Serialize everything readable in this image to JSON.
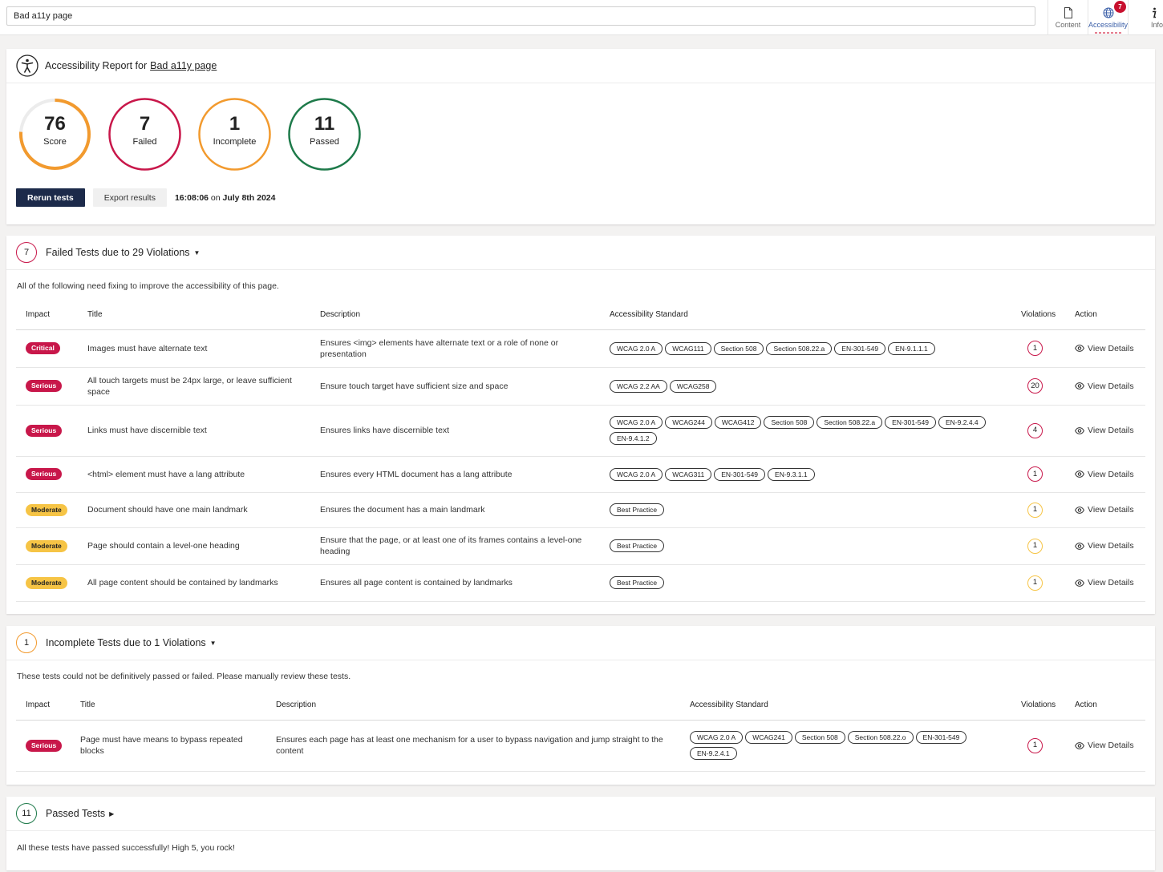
{
  "page_title_value": "Bad a11y page",
  "nav": [
    {
      "label": "Content",
      "icon": "document-icon"
    },
    {
      "label": "Accessibility",
      "icon": "globe-icon",
      "badge": "7"
    },
    {
      "label": "Info",
      "icon": "info-icon"
    }
  ],
  "report": {
    "heading": "Accessibility Report for",
    "page_link": "Bad a11y page",
    "score": {
      "value": "76",
      "label": "Score",
      "percent": 76
    },
    "failed": {
      "value": "7",
      "label": "Failed"
    },
    "incomplete": {
      "value": "1",
      "label": "Incomplete"
    },
    "passed": {
      "value": "11",
      "label": "Passed"
    },
    "rerun_label": "Rerun tests",
    "export_label": "Export results",
    "time": "16:08:06",
    "time_sep": " on ",
    "date": "July 8th 2024"
  },
  "colors": {
    "critical": "#c8174a",
    "moderate": "#f6c445",
    "passed": "#1e7a4a",
    "score": "#f29a2e",
    "navy": "#1c2a4a"
  },
  "failed_section": {
    "count": "7",
    "title": "Failed Tests due to 29 Violations",
    "intro": "All of the following need fixing to improve the accessibility of this page.",
    "columns": {
      "impact": "Impact",
      "title": "Title",
      "description": "Description",
      "standard": "Accessibility Standard",
      "violations": "Violations",
      "action": "Action"
    },
    "rows": [
      {
        "impact": "Critical",
        "level": "critical",
        "title": "Images must have alternate text",
        "description": "Ensures <img> elements have alternate text or a role of none or presentation",
        "tags": [
          "WCAG 2.0 A",
          "WCAG111",
          "Section 508",
          "Section 508.22.a",
          "EN-301-549",
          "EN-9.1.1.1"
        ],
        "violations": "1",
        "action": "View Details"
      },
      {
        "impact": "Serious",
        "level": "serious",
        "title": "All touch targets must be 24px large, or leave sufficient space",
        "description": "Ensure touch target have sufficient size and space",
        "tags": [
          "WCAG 2.2 AA",
          "WCAG258"
        ],
        "violations": "20",
        "action": "View Details"
      },
      {
        "impact": "Serious",
        "level": "serious",
        "title": "Links must have discernible text",
        "description": "Ensures links have discernible text",
        "tags": [
          "WCAG 2.0 A",
          "WCAG244",
          "WCAG412",
          "Section 508",
          "Section 508.22.a",
          "EN-301-549",
          "EN-9.2.4.4",
          "EN-9.4.1.2"
        ],
        "violations": "4",
        "action": "View Details"
      },
      {
        "impact": "Serious",
        "level": "serious",
        "title": "<html> element must have a lang attribute",
        "description": "Ensures every HTML document has a lang attribute",
        "tags": [
          "WCAG 2.0 A",
          "WCAG311",
          "EN-301-549",
          "EN-9.3.1.1"
        ],
        "violations": "1",
        "action": "View Details"
      },
      {
        "impact": "Moderate",
        "level": "moderate",
        "title": "Document should have one main landmark",
        "description": "Ensures the document has a main landmark",
        "tags": [
          "Best Practice"
        ],
        "violations": "1",
        "action": "View Details"
      },
      {
        "impact": "Moderate",
        "level": "moderate",
        "title": "Page should contain a level-one heading",
        "description": "Ensure that the page, or at least one of its frames contains a level-one heading",
        "tags": [
          "Best Practice"
        ],
        "violations": "1",
        "action": "View Details"
      },
      {
        "impact": "Moderate",
        "level": "moderate",
        "title": "All page content should be contained by landmarks",
        "description": "Ensures all page content is contained by landmarks",
        "tags": [
          "Best Practice"
        ],
        "violations": "1",
        "action": "View Details"
      }
    ]
  },
  "incomplete_section": {
    "count": "1",
    "title": "Incomplete Tests due to 1 Violations",
    "intro": "These tests could not be definitively passed or failed. Please manually review these tests.",
    "columns": {
      "impact": "Impact",
      "title": "Title",
      "description": "Description",
      "standard": "Accessibility Standard",
      "violations": "Violations",
      "action": "Action"
    },
    "rows": [
      {
        "impact": "Serious",
        "level": "serious",
        "title": "Page must have means to bypass repeated blocks",
        "description": "Ensures each page has at least one mechanism for a user to bypass navigation and jump straight to the content",
        "tags": [
          "WCAG 2.0 A",
          "WCAG241",
          "Section 508",
          "Section 508.22.o",
          "EN-301-549",
          "EN-9.2.4.1"
        ],
        "violations": "1",
        "action": "View Details"
      }
    ]
  },
  "passed_section": {
    "count": "11",
    "title": "Passed Tests",
    "intro": "All these tests have passed successfully! High 5, you rock!"
  }
}
